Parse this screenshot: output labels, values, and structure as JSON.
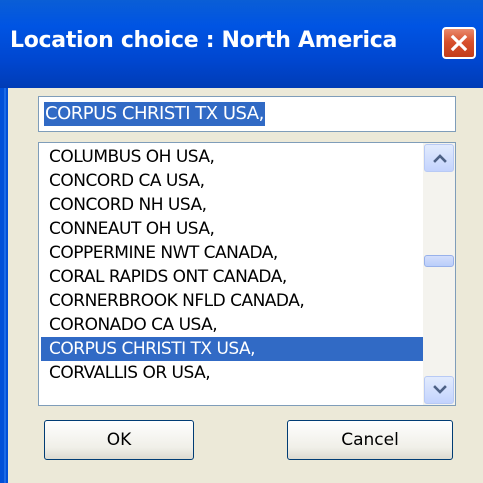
{
  "window": {
    "title": "Location choice : North America"
  },
  "location_field": {
    "value": "CORPUS CHRISTI TX USA,"
  },
  "location_list": {
    "items": [
      "COLUMBUS OH USA,",
      "CONCORD CA USA,",
      "CONCORD NH USA,",
      "CONNEAUT OH USA,",
      "COPPERMINE NWT CANADA,",
      "CORAL RAPIDS ONT CANADA,",
      "CORNERBROOK NFLD CANADA,",
      "CORONADO CA USA,",
      "CORPUS CHRISTI TX USA,",
      "CORVALLIS OR USA,"
    ],
    "selected_index": 8,
    "scroll_position": 0.43
  },
  "buttons": {
    "ok_label": "OK",
    "cancel_label": "Cancel"
  },
  "icons": {
    "close": "close-icon",
    "scroll_up": "chevron-up-icon",
    "scroll_down": "chevron-down-icon"
  },
  "colors": {
    "titlebar": "#0054e3",
    "close_button": "#d8512e",
    "selection": "#316ac5",
    "dialog_face": "#ece9d8"
  }
}
